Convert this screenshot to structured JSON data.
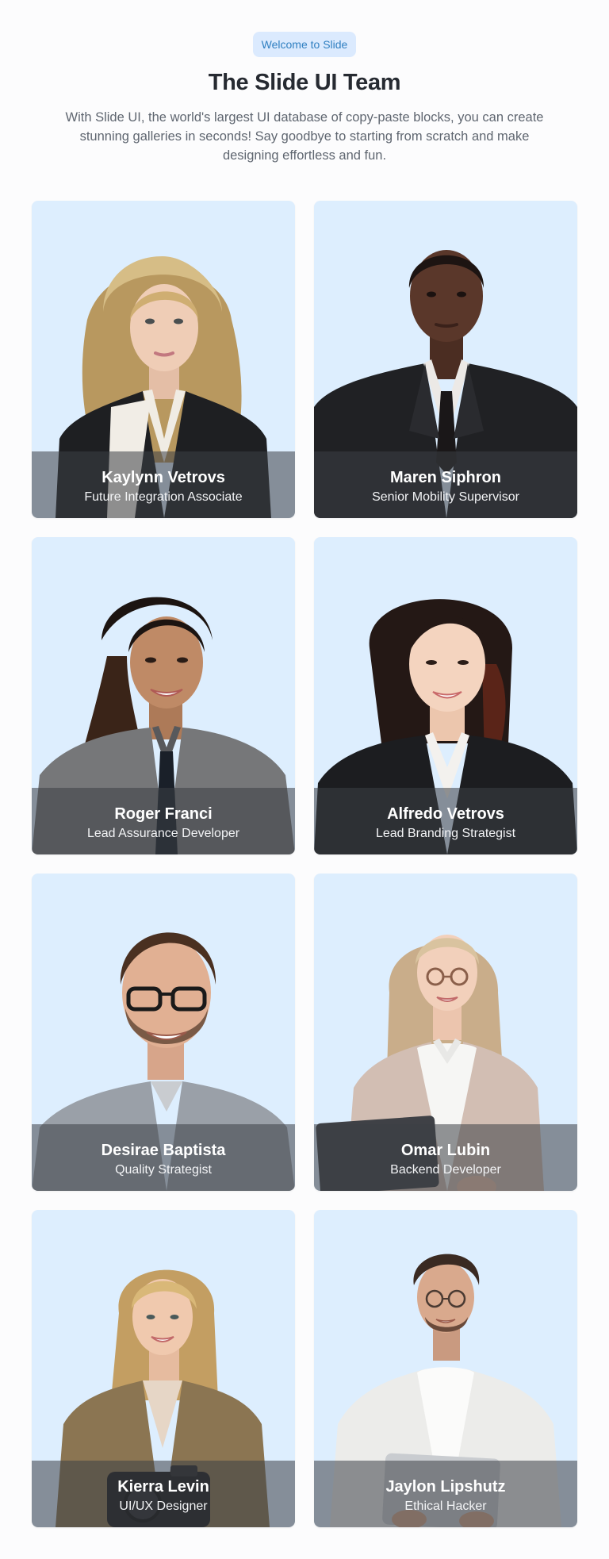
{
  "header": {
    "badge": "Welcome to Slide",
    "title": "The Slide UI Team",
    "description": "With Slide UI, the world's largest UI database of copy-paste blocks, you can create stunning galleries in seconds! Say goodbye to starting from scratch and make designing effortless and fun."
  },
  "members": [
    {
      "name": "Kaylynn Vetrovs",
      "role": "Future Integration Associate"
    },
    {
      "name": "Maren Siphron",
      "role": "Senior Mobility Supervisor"
    },
    {
      "name": "Roger Franci",
      "role": "Lead Assurance Developer"
    },
    {
      "name": "Alfredo Vetrovs",
      "role": "Lead Branding Strategist"
    },
    {
      "name": "Desirae Baptista",
      "role": "Quality Strategist"
    },
    {
      "name": "Omar Lubin",
      "role": "Backend Developer"
    },
    {
      "name": "Kierra Levin",
      "role": "UI/UX Designer"
    },
    {
      "name": "Jaylon Lipshutz",
      "role": "Ethical Hacker"
    }
  ],
  "colors": {
    "card_background": "#ddeefe",
    "badge_background": "#dbeafe",
    "badge_text": "#2f7fc1"
  }
}
